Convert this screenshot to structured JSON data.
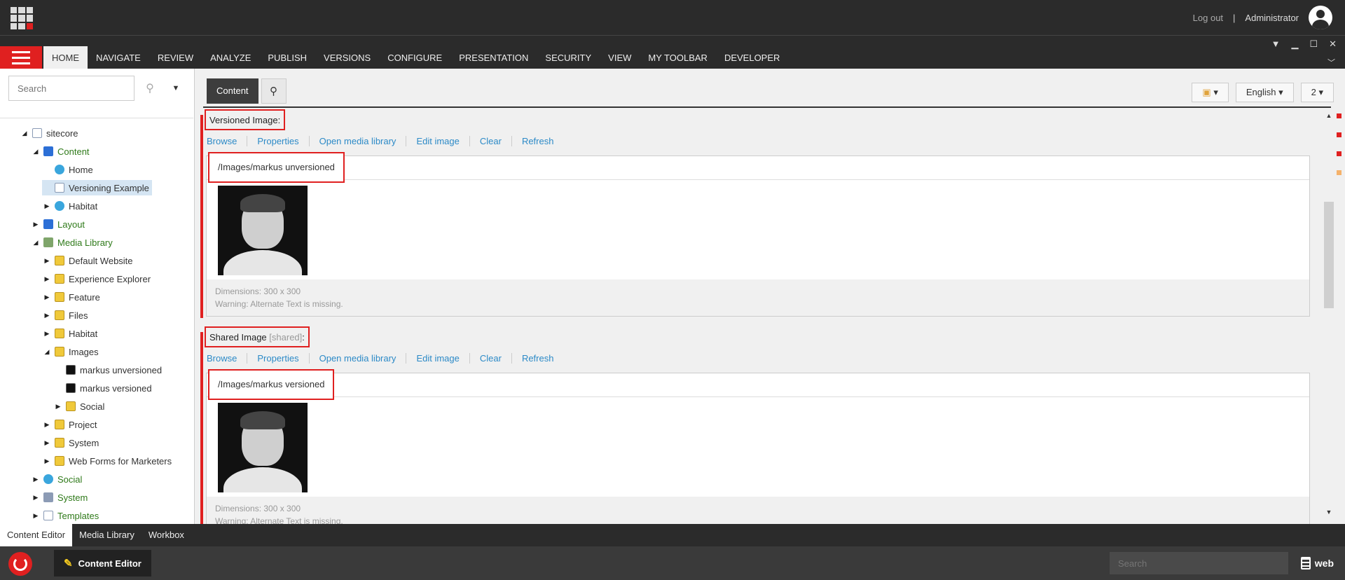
{
  "topbar": {
    "logout": "Log out",
    "separator": "|",
    "user": "Administrator"
  },
  "ribbon": {
    "tabs": [
      "HOME",
      "NAVIGATE",
      "REVIEW",
      "ANALYZE",
      "PUBLISH",
      "VERSIONS",
      "CONFIGURE",
      "PRESENTATION",
      "SECURITY",
      "VIEW",
      "MY TOOLBAR",
      "DEVELOPER"
    ],
    "active_tab": "HOME"
  },
  "sidebar": {
    "search_placeholder": "Search",
    "tree": [
      {
        "label": "sitecore",
        "icon": "doc-icon",
        "depth": 0,
        "expanded": true,
        "color": "dark"
      },
      {
        "label": "Content",
        "icon": "content-icon",
        "depth": 1,
        "expanded": true,
        "color": "green"
      },
      {
        "label": "Home",
        "icon": "home-icon",
        "depth": 2,
        "expanded": null,
        "color": "dark"
      },
      {
        "label": "Versioning Example",
        "icon": "doc-icon",
        "depth": 2,
        "expanded": null,
        "color": "dark",
        "selected": true
      },
      {
        "label": "Habitat",
        "icon": "globe-icon",
        "depth": 2,
        "expanded": false,
        "color": "dark"
      },
      {
        "label": "Layout",
        "icon": "layout-icon",
        "depth": 1,
        "expanded": false,
        "color": "green"
      },
      {
        "label": "Media Library",
        "icon": "media-icon",
        "depth": 1,
        "expanded": true,
        "color": "green"
      },
      {
        "label": "Default Website",
        "icon": "folder-icon",
        "depth": 2,
        "expanded": false,
        "color": "dark"
      },
      {
        "label": "Experience Explorer",
        "icon": "folder-icon",
        "depth": 2,
        "expanded": false,
        "color": "dark"
      },
      {
        "label": "Feature",
        "icon": "folder-icon",
        "depth": 2,
        "expanded": false,
        "color": "dark"
      },
      {
        "label": "Files",
        "icon": "folder-icon",
        "depth": 2,
        "expanded": false,
        "color": "dark"
      },
      {
        "label": "Habitat",
        "icon": "folder-icon",
        "depth": 2,
        "expanded": false,
        "color": "dark"
      },
      {
        "label": "Images",
        "icon": "folder-icon",
        "depth": 2,
        "expanded": true,
        "color": "dark"
      },
      {
        "label": "markus unversioned",
        "icon": "image-icon",
        "depth": 3,
        "expanded": null,
        "color": "dark"
      },
      {
        "label": "markus versioned",
        "icon": "image-icon",
        "depth": 3,
        "expanded": null,
        "color": "dark"
      },
      {
        "label": "Social",
        "icon": "folder-icon",
        "depth": 3,
        "expanded": false,
        "color": "dark"
      },
      {
        "label": "Project",
        "icon": "folder-icon",
        "depth": 2,
        "expanded": false,
        "color": "dark"
      },
      {
        "label": "System",
        "icon": "folder-icon",
        "depth": 2,
        "expanded": false,
        "color": "dark"
      },
      {
        "label": "Web Forms for Marketers",
        "icon": "folder-icon",
        "depth": 2,
        "expanded": false,
        "color": "dark"
      },
      {
        "label": "Social",
        "icon": "globe-icon",
        "depth": 1,
        "expanded": false,
        "color": "green"
      },
      {
        "label": "System",
        "icon": "system-icon",
        "depth": 1,
        "expanded": false,
        "color": "green"
      },
      {
        "label": "Templates",
        "icon": "templates-icon",
        "depth": 1,
        "expanded": false,
        "color": "green"
      }
    ]
  },
  "content_toolbar": {
    "content_tab": "Content",
    "language": "English",
    "version": "2"
  },
  "fields": [
    {
      "label": "Versioned Image:",
      "shared_tag": "",
      "actions": [
        "Browse",
        "Properties",
        "Open media library",
        "Edit image",
        "Clear",
        "Refresh"
      ],
      "path": "/Images/markus unversioned",
      "dimensions": "Dimensions: 300 x 300",
      "warning": "Warning: Alternate Text is missing."
    },
    {
      "label": "Shared Image",
      "shared_tag": "[shared]",
      "label_suffix": ":",
      "actions": [
        "Browse",
        "Properties",
        "Open media library",
        "Edit image",
        "Clear",
        "Refresh"
      ],
      "path": "/Images/markus versioned",
      "dimensions": "Dimensions: 300 x 300",
      "warning": "Warning: Alternate Text is missing."
    }
  ],
  "bottom_tabs": [
    "Content Editor",
    "Media Library",
    "Workbox"
  ],
  "taskbar": {
    "app_button": "Content Editor",
    "search_placeholder": "Search",
    "database": "web"
  }
}
